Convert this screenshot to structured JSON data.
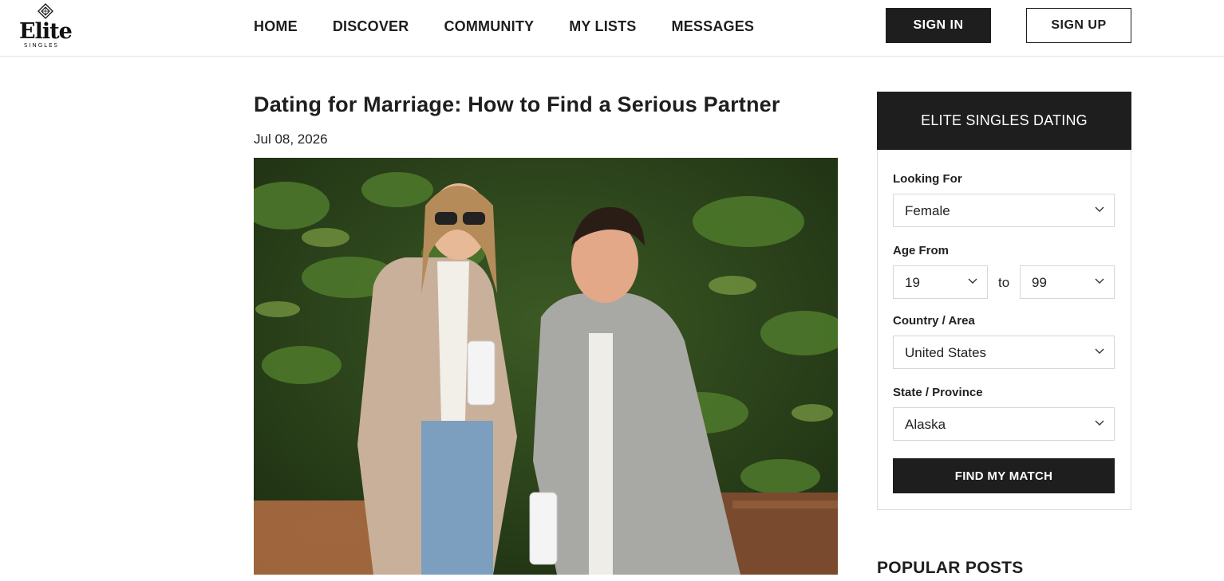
{
  "brand": {
    "name": "Elite",
    "tagline": "SINGLES"
  },
  "nav": {
    "items": [
      "HOME",
      "DISCOVER",
      "COMMUNITY",
      "MY LISTS",
      "MESSAGES"
    ]
  },
  "auth": {
    "sign_in": "SIGN IN",
    "sign_up": "SIGN UP"
  },
  "article": {
    "title": "Dating for Marriage: How to Find a Serious Partner",
    "date": "Jul 08, 2026"
  },
  "search_widget": {
    "heading": "ELITE SINGLES DATING",
    "looking_for": {
      "label": "Looking For",
      "value": "Female"
    },
    "age": {
      "label": "Age From",
      "from": "19",
      "to_label": "to",
      "to": "99"
    },
    "country": {
      "label": "Country / Area",
      "value": "United States"
    },
    "state": {
      "label": "State / Province",
      "value": "Alaska"
    },
    "submit": "FIND MY MATCH"
  },
  "popular_posts": {
    "heading": "POPULAR POSTS"
  },
  "colors": {
    "dark": "#1e1e1e",
    "border": "#dcdcdc",
    "white": "#ffffff"
  }
}
